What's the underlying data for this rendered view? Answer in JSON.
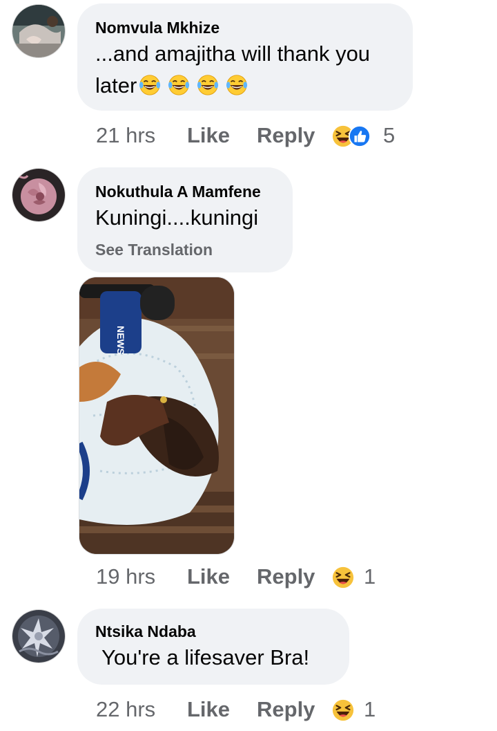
{
  "comments": [
    {
      "author": "Nomvula Mkhize",
      "lines": [
        "...and amajitha will thank you",
        "later"
      ],
      "line2_emojis": [
        "laughing-tears",
        "laughing-tears",
        "laughing-tears",
        "laughing-tears"
      ],
      "time": "21 hrs",
      "like_label": "Like",
      "reply_label": "Reply",
      "reactions": [
        "haha",
        "like"
      ],
      "reaction_count": "5"
    },
    {
      "author": "Nokuthula A Mamfene",
      "text": "Kuningi....kuningi",
      "translate_label": "See Translation",
      "time": "19 hrs",
      "like_label": "Like",
      "reply_label": "Reply",
      "reactions": [
        "haha"
      ],
      "reaction_count": "1"
    },
    {
      "author": "Ntsika Ndaba",
      "text": "You're a lifesaver Bra!",
      "time": "22 hrs",
      "like_label": "Like",
      "reply_label": "Reply",
      "reactions": [
        "haha"
      ],
      "reaction_count": "1"
    }
  ],
  "colors": {
    "bubble": "#f0f2f5",
    "meta_text": "#65676b",
    "primary_text": "#050505",
    "like_blue": "#1877f2",
    "haha_yellow": "#f7c23b"
  }
}
